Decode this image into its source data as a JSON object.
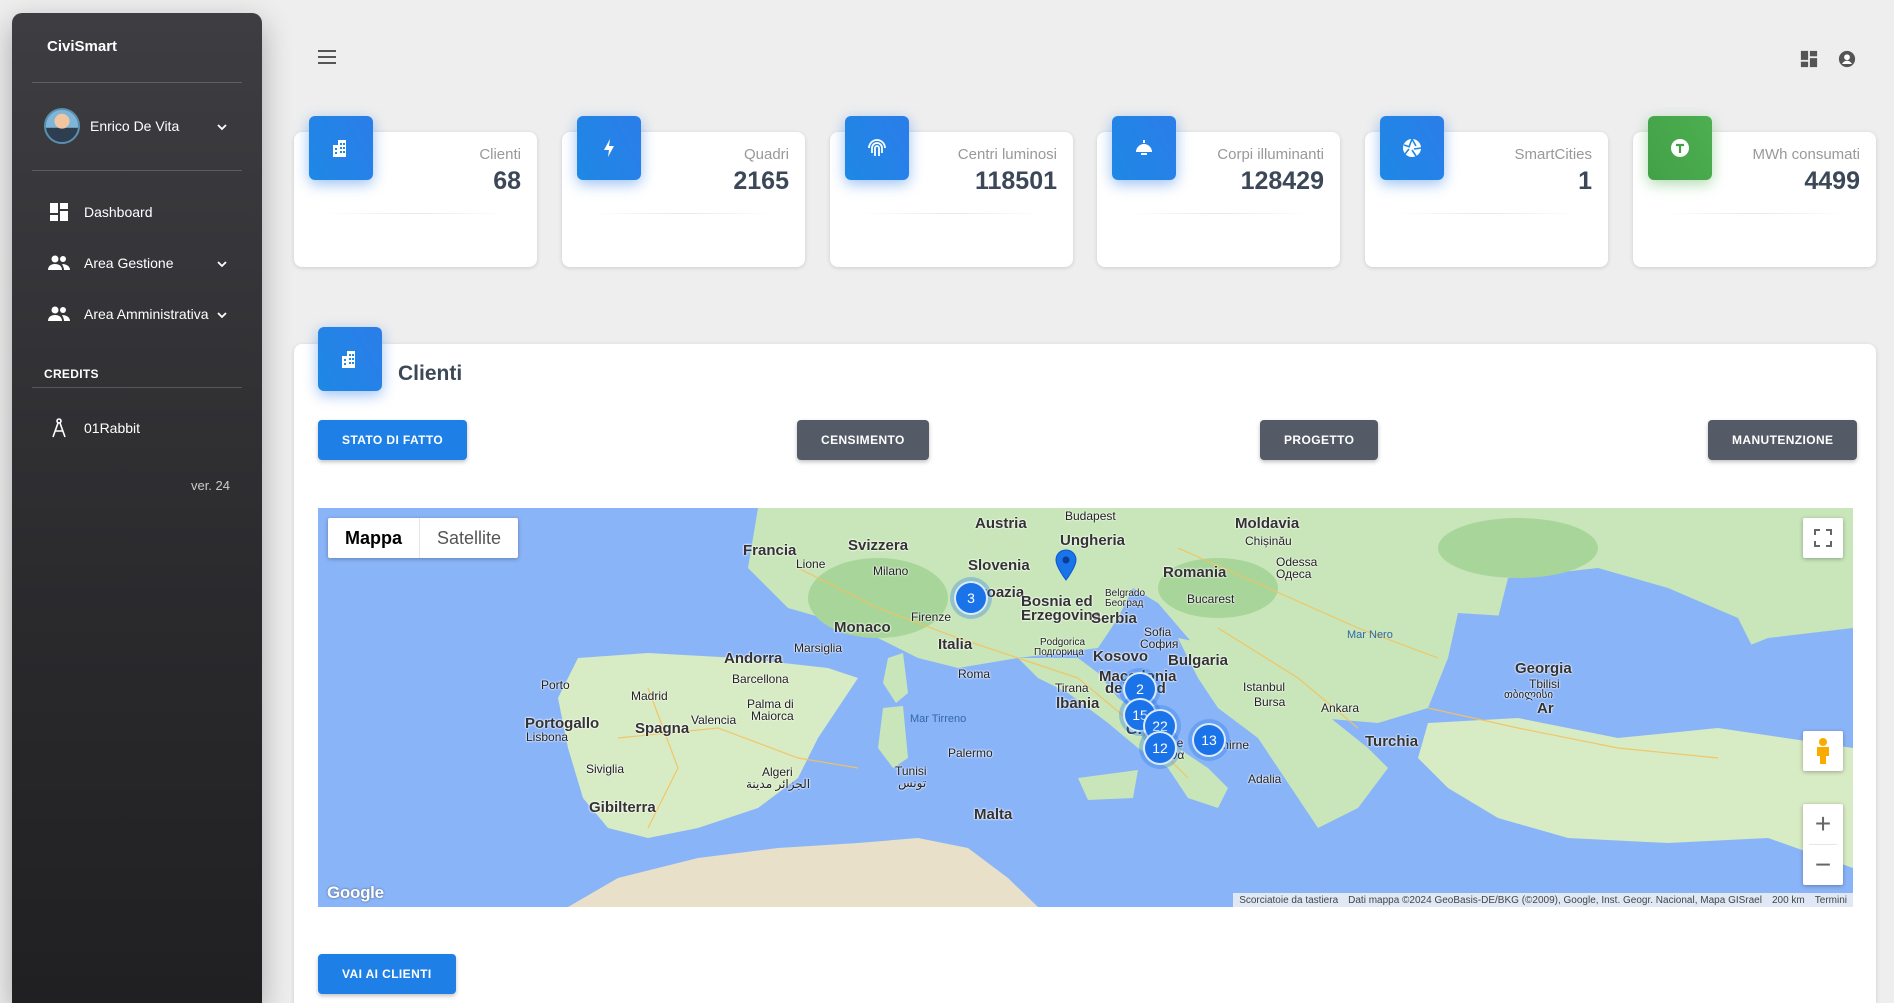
{
  "sidebar": {
    "brand": "CiviSmart",
    "user_name": "Enrico De Vita",
    "items": [
      {
        "label": "Dashboard",
        "icon": "dashboard-icon"
      },
      {
        "label": "Area Gestione",
        "icon": "people-icon"
      },
      {
        "label": "Area Amministrativa",
        "icon": "people-icon"
      }
    ],
    "credits_heading": "CREDITS",
    "credits_item": "01Rabbit",
    "version": "ver. 24"
  },
  "stats": [
    {
      "label": "Clienti",
      "value": "68",
      "icon": "building-icon",
      "color": "#1e88e5"
    },
    {
      "label": "Quadri",
      "value": "2165",
      "icon": "bolt-icon",
      "color": "#1e88e5"
    },
    {
      "label": "Centri luminosi",
      "value": "118501",
      "icon": "fingerprint-icon",
      "color": "#1e88e5"
    },
    {
      "label": "Corpi illuminanti",
      "value": "128429",
      "icon": "lamp-icon",
      "color": "#1e88e5"
    },
    {
      "label": "SmartCities",
      "value": "1",
      "icon": "aperture-icon",
      "color": "#1e88e5"
    },
    {
      "label": "MWh consumati",
      "value": "4499",
      "icon": "meter-icon",
      "color": "#43a047"
    }
  ],
  "panel": {
    "title": "Clienti",
    "buttons": {
      "stato": "STATO DI FATTO",
      "censimento": "CENSIMENTO",
      "progetto": "PROGETTO",
      "manutenzione": "MANUTENZIONE"
    },
    "bottom_button": "VAI AI CLIENTI"
  },
  "map": {
    "types": [
      "Mappa",
      "Satellite"
    ],
    "clusters": [
      "3",
      "2",
      "15",
      "22",
      "12",
      "13"
    ],
    "labels": {
      "austria": "Austria",
      "budapest": "Budapest",
      "moldavia": "Moldavia",
      "chisinau": "Chișinău",
      "ungheria": "Ungheria",
      "francia": "Francia",
      "svizzera": "Svizzera",
      "lione": "Lione",
      "milano": "Milano",
      "slovenia": "Slovenia",
      "odessa": "Odessa",
      "odessa_cyr": "Одеса",
      "romania": "Romania",
      "croazia": "Croazia",
      "belgrado": "Belgrado",
      "beograd": "Београд",
      "bucarest": "Bucarest",
      "bosnia": "Bosnia ed",
      "erzegovina": "Erzegovina",
      "serbia": "Serbia",
      "monaco": "Monaco",
      "firenze": "Firenze",
      "mar_nero": "Mar Nero",
      "marsiglia": "Marsiglia",
      "italia": "Italia",
      "podgorica": "Podgorica",
      "podgorica_cyr": "Подгорица",
      "sofia": "Sofia",
      "sofia_cyr": "София",
      "kosovo": "Kosovo",
      "andorra": "Andorra",
      "bulgaria": "Bulgaria",
      "georgia": "Georgia",
      "roma": "Roma",
      "barcellona": "Barcellona",
      "macedonia": "Macedonia",
      "del_nord": "del Nord",
      "porto": "Porto",
      "tirana": "Tirana",
      "albania": "lbania",
      "istanbul": "Istanbul",
      "tbilisi": "Tbilisi",
      "madrid": "Madrid",
      "palma": "Palma di",
      "maiorca": "Maiorca",
      "bursa": "Bursa",
      "ankara": "Ankara",
      "tbilisi_geo": "თბილისი",
      "mar_tirreno": "Mar Tirreno",
      "portogallo": "Portogallo",
      "valencia": "Valencia",
      "spagna": "Spagna",
      "lisbona": "Lisbona",
      "grecia": "Grecia",
      "turchia": "Turchia",
      "atene": "Atene",
      "atene_gr": "Αθήνα",
      "smirne": "Smirne",
      "palermo": "Palermo",
      "siviglia": "Siviglia",
      "algeri": "Algeri",
      "algeri_ar": "الجزائر مدينة",
      "tunisi": "Tunisi",
      "tunisi_ar": "تونس",
      "adalia": "Adalia",
      "gibilterra": "Gibilterra",
      "malta": "Malta",
      "armenia": "Ar"
    },
    "attribution": [
      "Scorciatoie da tastiera",
      "Dati mappa ©2024 GeoBasis-DE/BKG (©2009), Google, Inst. Geogr. Nacional, Mapa GISrael",
      "200 km",
      "Termini"
    ],
    "google": "Google",
    "colors": {
      "water": "#8ab4f8",
      "land": "#c8e6b9",
      "forest": "#a8d59a"
    }
  }
}
